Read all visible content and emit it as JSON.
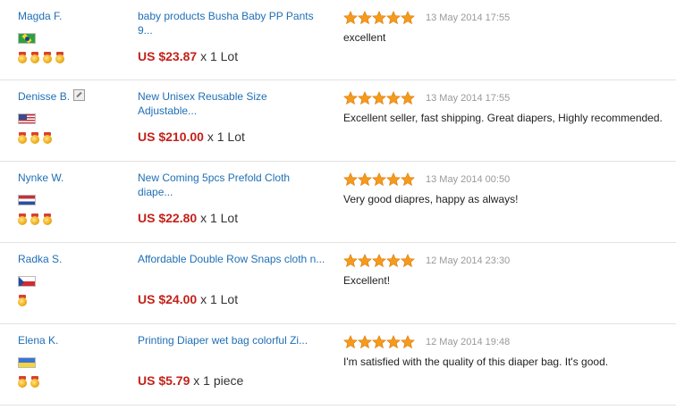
{
  "feedback": [
    {
      "buyer": "Magda F.",
      "verified": false,
      "flag": "flag-br",
      "medals": 4,
      "product_title": "baby products Busha Baby PP Pants 9...",
      "price": "US $23.87",
      "quantity": "x 1 Lot",
      "rating": 5,
      "date": "13 May 2014 17:55",
      "comment": "excellent"
    },
    {
      "buyer": "Denisse B.",
      "verified": true,
      "flag": "flag-us",
      "medals": 3,
      "product_title": "New Unisex Reusable Size Adjustable...",
      "price": "US $210.00",
      "quantity": "x 1 Lot",
      "rating": 5,
      "date": "13 May 2014 17:55",
      "comment": "Excellent seller, fast shipping. Great diapers, Highly recommended."
    },
    {
      "buyer": "Nynke W.",
      "verified": false,
      "flag": "flag-nl",
      "medals": 3,
      "product_title": "New Coming 5pcs Prefold Cloth diape...",
      "price": "US $22.80",
      "quantity": "x 1 Lot",
      "rating": 5,
      "date": "13 May 2014 00:50",
      "comment": "Very good diapres, happy as always!"
    },
    {
      "buyer": "Radka S.",
      "verified": false,
      "flag": "flag-cz",
      "medals": 1,
      "product_title": "Affordable Double Row Snaps cloth n...",
      "price": "US $24.00",
      "quantity": "x 1 Lot",
      "rating": 5,
      "date": "12 May 2014 23:30",
      "comment": "Excellent!"
    },
    {
      "buyer": "Elena K.",
      "verified": false,
      "flag": "flag-ua",
      "medals": 2,
      "product_title": "Printing Diaper wet bag colorful Zi...",
      "price": "US $5.79",
      "quantity": "x 1 piece",
      "rating": 5,
      "date": "12 May 2014 19:48",
      "comment": "I'm satisfied with the quality of this diaper bag. It's good."
    }
  ],
  "icons": {
    "star": "star-icon",
    "medal": "medal-icon",
    "verified": "verified-icon"
  },
  "colors": {
    "link": "#1f6fb5",
    "price": "#c4211a",
    "star": "#f59a1b",
    "date": "#999999"
  }
}
